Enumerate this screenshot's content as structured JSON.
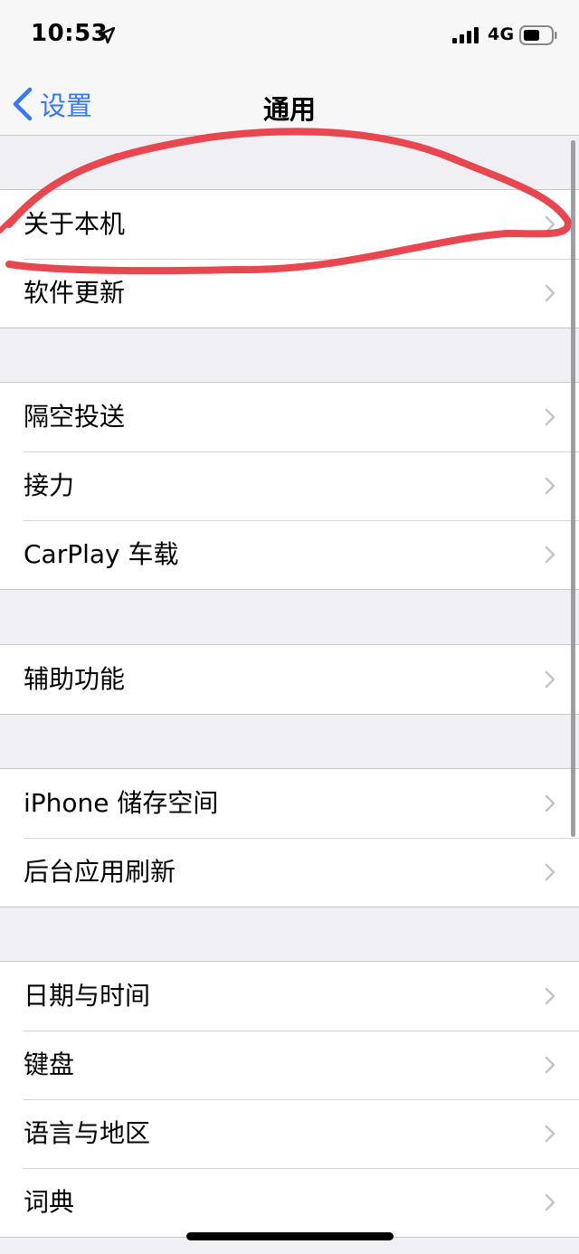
{
  "status_bar": {
    "time": "10:53",
    "network": "4G",
    "icons": [
      "location-arrow-icon",
      "cellular-signal-icon",
      "battery-icon"
    ]
  },
  "nav": {
    "back_label": "设置",
    "title": "通用"
  },
  "sections": [
    {
      "rows": [
        {
          "label": "关于本机"
        },
        {
          "label": "软件更新"
        }
      ]
    },
    {
      "rows": [
        {
          "label": "隔空投送"
        },
        {
          "label": "接力"
        },
        {
          "label": "CarPlay 车载"
        }
      ]
    },
    {
      "rows": [
        {
          "label": "辅助功能"
        }
      ]
    },
    {
      "rows": [
        {
          "label": "iPhone 储存空间"
        },
        {
          "label": "后台应用刷新"
        }
      ]
    },
    {
      "rows": [
        {
          "label": "日期与时间"
        },
        {
          "label": "键盘"
        },
        {
          "label": "语言与地区"
        },
        {
          "label": "词典"
        }
      ]
    }
  ],
  "colors": {
    "accent": "#3478f6",
    "annotation": "#e8474f",
    "background": "#efeff4"
  }
}
